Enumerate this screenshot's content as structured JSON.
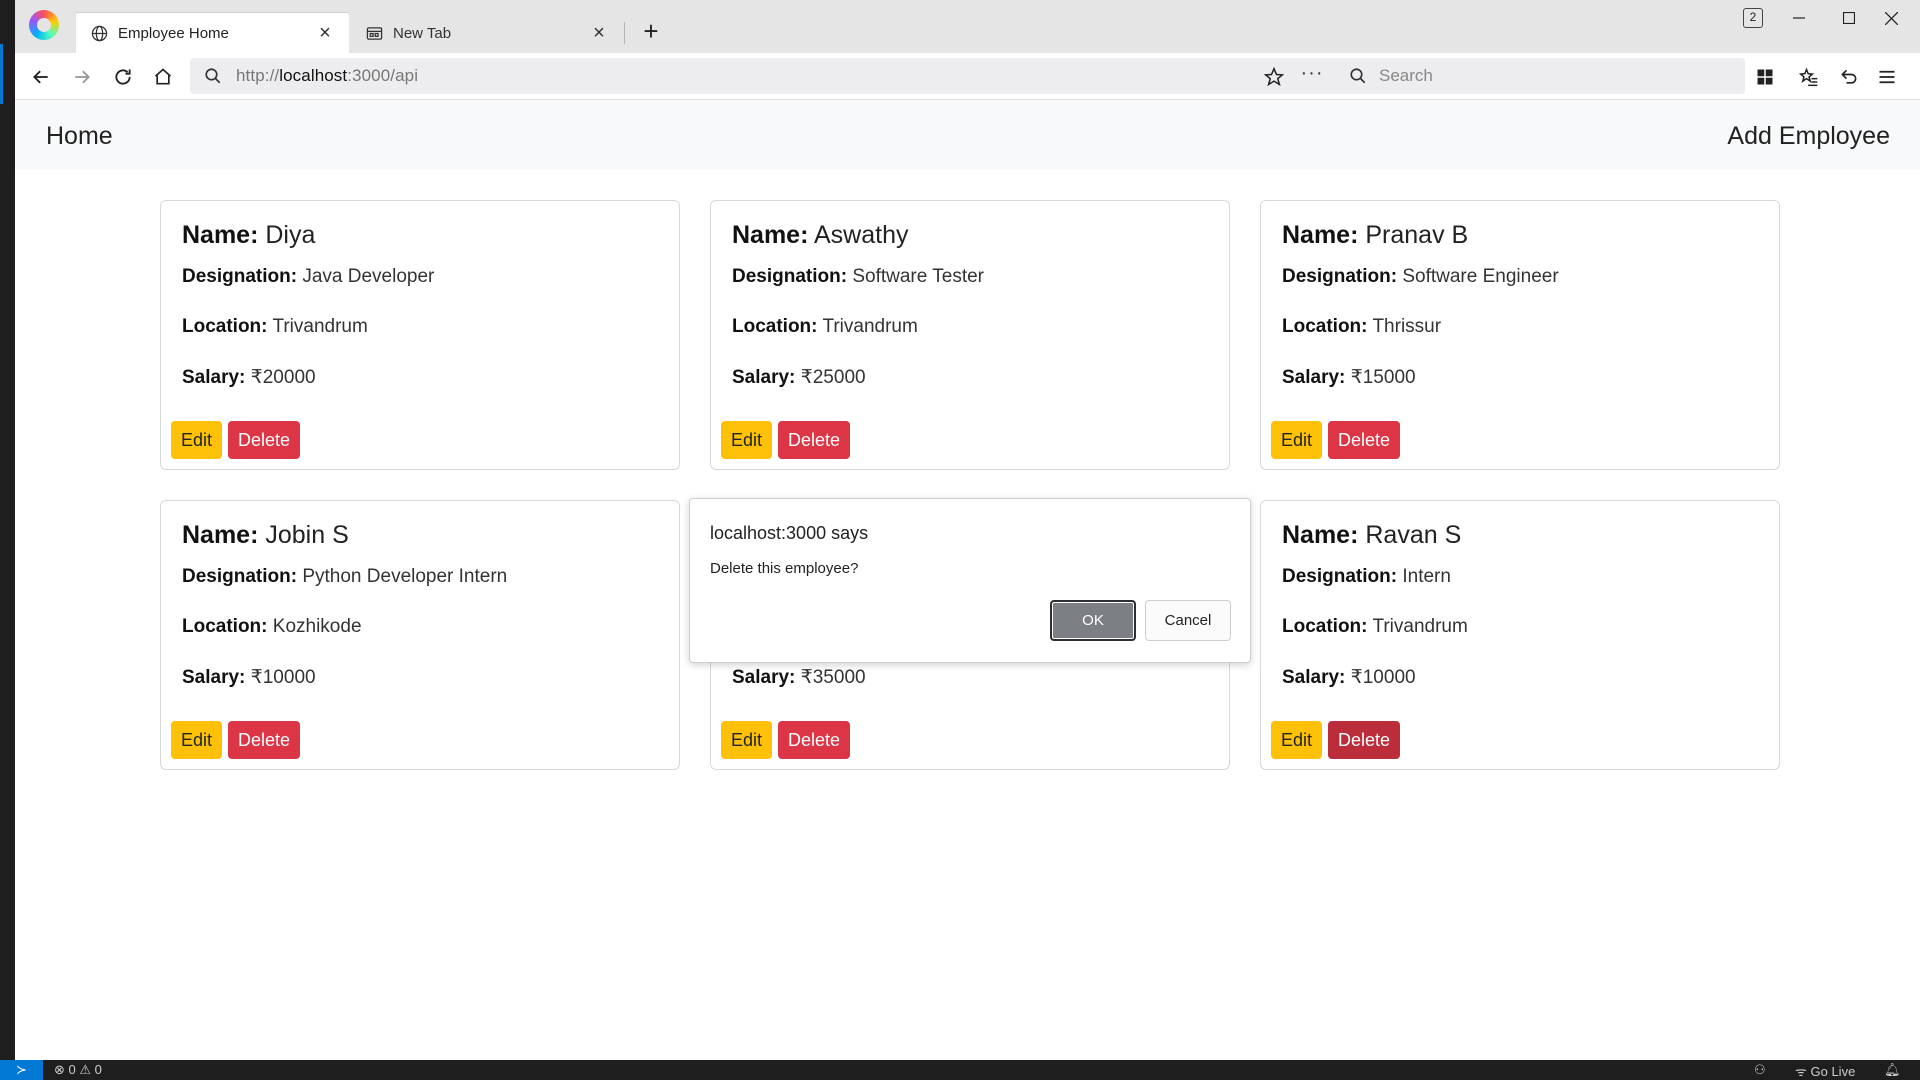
{
  "browser": {
    "tabs": [
      {
        "title": "Employee Home",
        "active": true,
        "icon": "globe-icon"
      },
      {
        "title": "New Tab",
        "active": false,
        "icon": "newtab-page-icon"
      }
    ],
    "tab_count": "2",
    "url_scheme": "http://",
    "url_host": "localhost",
    "url_rest": ":3000/api",
    "search_placeholder": "Search"
  },
  "navbar": {
    "home_label": "Home",
    "add_label": "Add Employee"
  },
  "labels": {
    "name": "Name:",
    "designation": "Designation:",
    "location": "Location:",
    "salary": "Salary:",
    "edit": "Edit",
    "delete": "Delete"
  },
  "employees": [
    {
      "name": "Diya",
      "designation": "Java Developer",
      "location": "Trivandrum",
      "salary": "₹20000"
    },
    {
      "name": "Aswathy",
      "designation": "Software Tester",
      "location": "Trivandrum",
      "salary": "₹25000"
    },
    {
      "name": "Pranav B",
      "designation": "Software Engineer",
      "location": "Thrissur",
      "salary": "₹15000"
    },
    {
      "name": "Jobin S",
      "designation": "Python Developer Intern",
      "location": "Kozhikode",
      "salary": "₹10000"
    },
    {
      "name": "",
      "designation": "",
      "location": "",
      "salary": "₹35000"
    },
    {
      "name": "Ravan S",
      "designation": "Intern",
      "location": "Trivandrum",
      "salary": "₹10000"
    }
  ],
  "dialog": {
    "title": "localhost:3000 says",
    "message": "Delete this employee?",
    "ok_label": "OK",
    "cancel_label": "Cancel"
  },
  "statusbar": {
    "errors": "0",
    "warnings": "0",
    "go_live": "Go Live"
  },
  "colors": {
    "edit_button": "#ffc107",
    "delete_button": "#dc3545",
    "delete_button_hover": "#bb2d3b",
    "navbar_bg": "#f8f9fa",
    "statusbar_accent": "#0078d4"
  }
}
